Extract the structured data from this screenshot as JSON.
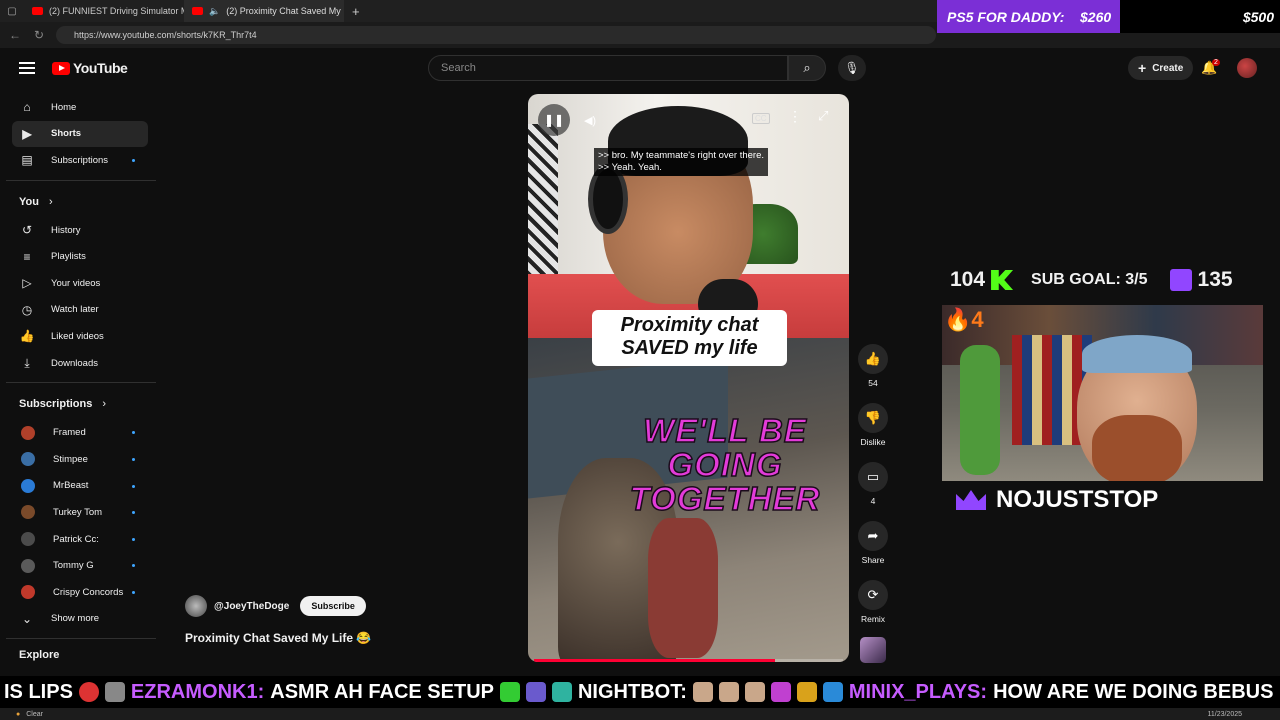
{
  "browser": {
    "tabs": [
      {
        "title": "(2) FUNNIEST Driving Simulator M",
        "active": false
      },
      {
        "title": "(2) Proximity Chat Saved My",
        "active": true
      }
    ],
    "url": "https://www.youtube.com/shorts/k7KR_Thr7t4"
  },
  "stream_overlay": {
    "donation_goal_label": "PS5 FOR DADDY:",
    "donation_current": "$260",
    "donation_target": "$500",
    "kick_followers": "104",
    "sub_goal_label": "SUB GOAL: 3/5",
    "twitch_count": "135",
    "cam_counter": "4",
    "streamer_name": "NOJUSTSTOP",
    "ticker_parts": [
      "IS LIPS",
      "EZRAMONK1:",
      "ASMR AH FACE SETUP",
      "NIGHTBOT:",
      "MINIX_PLAYS:",
      "HOW ARE WE DOING BEBUS"
    ]
  },
  "header": {
    "logo_text": "YouTube",
    "search_placeholder": "Search",
    "create_label": "Create",
    "notification_count": "2"
  },
  "sidebar": {
    "main": [
      {
        "label": "Home",
        "icon": "home-icon"
      },
      {
        "label": "Shorts",
        "icon": "shorts-icon"
      },
      {
        "label": "Subscriptions",
        "icon": "subscriptions-icon"
      }
    ],
    "you_heading": "You",
    "you_items": [
      {
        "label": "History"
      },
      {
        "label": "Playlists"
      },
      {
        "label": "Your videos"
      },
      {
        "label": "Watch later"
      },
      {
        "label": "Liked videos"
      },
      {
        "label": "Downloads"
      }
    ],
    "subscriptions_heading": "Subscriptions",
    "subscriptions": [
      {
        "label": "Framed",
        "color": "#b0402a"
      },
      {
        "label": "Stimpee",
        "color": "#3a6ea5"
      },
      {
        "label": "MrBeast",
        "color": "#2a7bd6"
      },
      {
        "label": "Turkey Tom",
        "color": "#7a4a2a"
      },
      {
        "label": "Patrick Cc:",
        "color": "#4b4b4b"
      },
      {
        "label": "Tommy G",
        "color": "#5a5a5a"
      },
      {
        "label": "Crispy Concords",
        "color": "#c0392b"
      }
    ],
    "show_more": "Show more",
    "explore_heading": "Explore"
  },
  "short": {
    "captions": [
      ">> bro. My teammate's right over there.",
      ">> Yeah. Yeah."
    ],
    "title_card": "Proximity chat SAVED my life",
    "overlay_text": "WE'LL BE GOING TOGETHER",
    "cc_label": "CC",
    "progress": 0.78,
    "channel": "@JoeyTheDoge",
    "subscribe_label": "Subscribe",
    "title": "Proximity Chat Saved My Life 😂"
  },
  "actions": {
    "likes": "54",
    "dislike_label": "Dislike",
    "comments": "4",
    "share_label": "Share",
    "remix_label": "Remix"
  },
  "taskbar": {
    "weather": "Clear",
    "date": "11/23/2025"
  }
}
